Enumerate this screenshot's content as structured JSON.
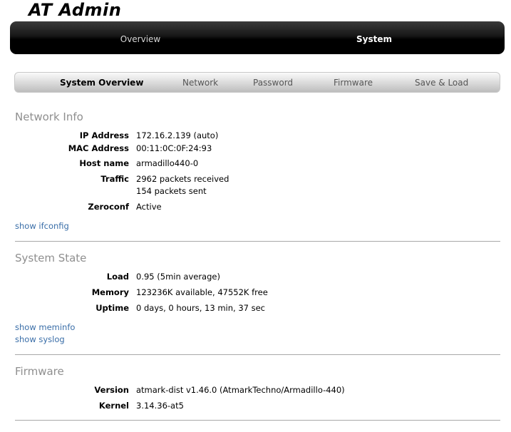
{
  "app": {
    "title": "AT Admin"
  },
  "main_nav": {
    "overview": "Overview",
    "system": "System"
  },
  "sub_nav": {
    "tabs": [
      {
        "label": "System Overview",
        "active": true
      },
      {
        "label": "Network",
        "active": false
      },
      {
        "label": "Password",
        "active": false
      },
      {
        "label": "Firmware",
        "active": false
      },
      {
        "label": "Save & Load",
        "active": false
      }
    ]
  },
  "network_info": {
    "title": "Network Info",
    "ip_label": "IP Address",
    "ip_value": "172.16.2.139 (auto)",
    "mac_label": "MAC Address",
    "mac_value": "00:11:0C:0F:24:93",
    "host_label": "Host name",
    "host_value": "armadillo440-0",
    "traffic_label": "Traffic",
    "traffic_received": "2962 packets received",
    "traffic_sent": "154 packets sent",
    "zeroconf_label": "Zeroconf",
    "zeroconf_value": "Active",
    "link_ifconfig": "show ifconfig"
  },
  "system_state": {
    "title": "System State",
    "load_label": "Load",
    "load_value": "0.95 (5min average)",
    "memory_label": "Memory",
    "memory_value": "123236K available, 47552K free",
    "uptime_label": "Uptime",
    "uptime_value": "0 days, 0 hours, 13 min, 37 sec",
    "link_meminfo": "show meminfo",
    "link_syslog": "show syslog"
  },
  "firmware": {
    "title": "Firmware",
    "version_label": "Version",
    "version_value": "atmark-dist v1.46.0 (AtmarkTechno/Armadillo-440)",
    "kernel_label": "Kernel",
    "kernel_value": "3.14.36-at5"
  }
}
